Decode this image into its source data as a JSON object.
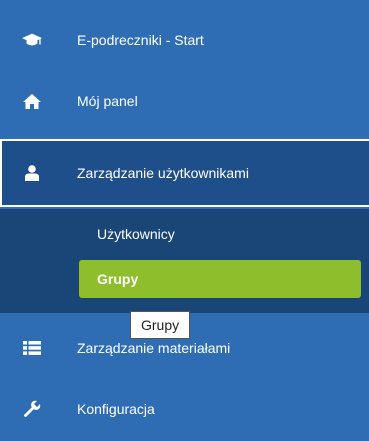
{
  "sidebar": {
    "items": [
      {
        "label": "E-podreczniki - Start",
        "icon": "graduation-cap-icon"
      },
      {
        "label": "Mój panel",
        "icon": "home-icon"
      },
      {
        "label": "Zarządzanie użytkownikami",
        "icon": "user-icon"
      },
      {
        "label": "Zarządzanie materiałami",
        "icon": "list-icon"
      },
      {
        "label": "Konfiguracja",
        "icon": "wrench-icon"
      }
    ],
    "submenu": [
      {
        "label": "Użytkownicy"
      },
      {
        "label": "Grupy"
      }
    ],
    "tooltip": "Grupy",
    "colors": {
      "sidebar_bg": "#2e6db4",
      "active_bg": "#1f4f8a",
      "submenu_bg": "#194577",
      "selected_bg": "#8fbe2c"
    }
  }
}
